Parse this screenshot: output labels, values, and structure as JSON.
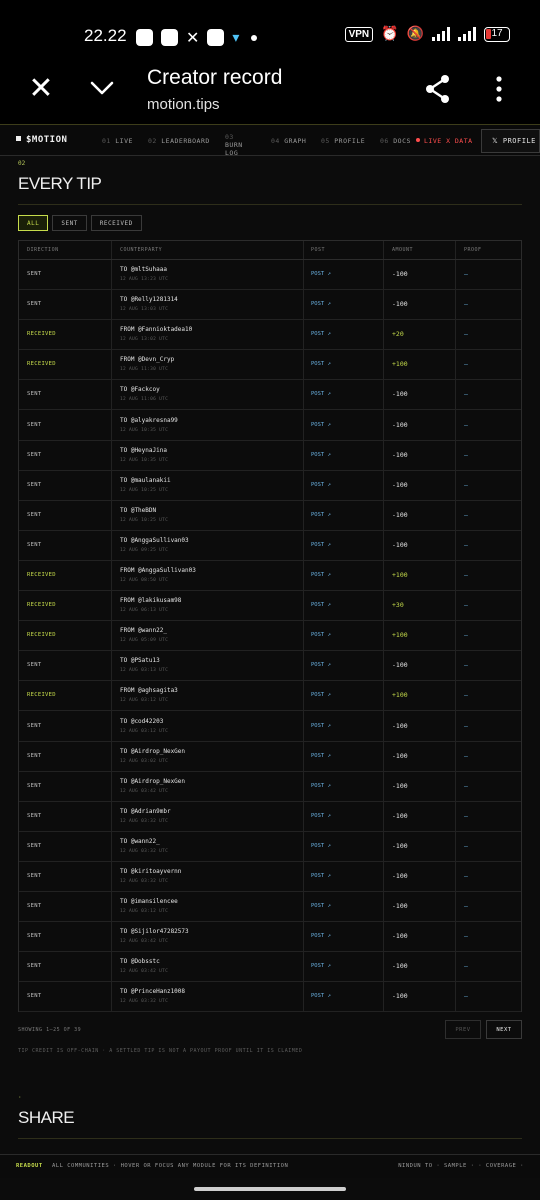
{
  "status_bar": {
    "time": "22.22",
    "vpn": "VPN",
    "battery": "17"
  },
  "browser": {
    "title": "Creator record",
    "url": "motion.tips"
  },
  "nav": {
    "brand": "$MOTION",
    "items": [
      {
        "num": "01",
        "label": "LIVE"
      },
      {
        "num": "02",
        "label": "LEADERBOARD"
      },
      {
        "num": "03",
        "label": "BURN LOG"
      },
      {
        "num": "04",
        "label": "GRAPH"
      },
      {
        "num": "05",
        "label": "PROFILE"
      },
      {
        "num": "06",
        "label": "DOCS"
      }
    ],
    "live_data": "LIVE X DATA",
    "profile_button": "𝕏 PROFILE"
  },
  "section": {
    "num": "02",
    "title": "EVERY TIP",
    "filters": [
      "ALL",
      "SENT",
      "RECEIVED"
    ],
    "active_filter": "ALL"
  },
  "table": {
    "headers": [
      "DIRECTION",
      "COUNTERPARTY",
      "POST",
      "AMOUNT",
      "PROOF"
    ],
    "rows": [
      {
        "dir": "SENT",
        "cp": "TO @mltSuhaaa",
        "time": "12 AUG 13:23 UTC",
        "post": "POST ↗",
        "amt": "-100",
        "proof": "—"
      },
      {
        "dir": "SENT",
        "cp": "TO @Relly1281314",
        "time": "12 AUG 13:03 UTC",
        "post": "POST ↗",
        "amt": "-100",
        "proof": "—"
      },
      {
        "dir": "RECEIVED",
        "cp": "FROM @Fannioktadea10",
        "time": "12 AUG 13:02 UTC",
        "post": "POST ↗",
        "amt": "+20",
        "proof": "—"
      },
      {
        "dir": "RECEIVED",
        "cp": "FROM @Devn_Cryp",
        "time": "12 AUG 11:30 UTC",
        "post": "POST ↗",
        "amt": "+100",
        "proof": "—"
      },
      {
        "dir": "SENT",
        "cp": "TO @Fackcoy",
        "time": "12 AUG 11:06 UTC",
        "post": "POST ↗",
        "amt": "-100",
        "proof": "—"
      },
      {
        "dir": "SENT",
        "cp": "TO @alyakresna99",
        "time": "12 AUG 10:35 UTC",
        "post": "POST ↗",
        "amt": "-100",
        "proof": "—"
      },
      {
        "dir": "SENT",
        "cp": "TO @HeynaJina",
        "time": "12 AUG 10:35 UTC",
        "post": "POST ↗",
        "amt": "-100",
        "proof": "—"
      },
      {
        "dir": "SENT",
        "cp": "TO @maulanakii",
        "time": "12 AUG 10:25 UTC",
        "post": "POST ↗",
        "amt": "-100",
        "proof": "—"
      },
      {
        "dir": "SENT",
        "cp": "TO @TheBDN",
        "time": "12 AUG 10:25 UTC",
        "post": "POST ↗",
        "amt": "-100",
        "proof": "—"
      },
      {
        "dir": "SENT",
        "cp": "TO @AnggaSullivan03",
        "time": "12 AUG 09:25 UTC",
        "post": "POST ↗",
        "amt": "-100",
        "proof": "—"
      },
      {
        "dir": "RECEIVED",
        "cp": "FROM @AnggaSullivan03",
        "time": "12 AUG 08:50 UTC",
        "post": "POST ↗",
        "amt": "+100",
        "proof": "—"
      },
      {
        "dir": "RECEIVED",
        "cp": "FROM @lakikusam98",
        "time": "12 AUG 06:13 UTC",
        "post": "POST ↗",
        "amt": "+30",
        "proof": "—"
      },
      {
        "dir": "RECEIVED",
        "cp": "FROM @wann22_",
        "time": "12 AUG 05:09 UTC",
        "post": "POST ↗",
        "amt": "+100",
        "proof": "—"
      },
      {
        "dir": "SENT",
        "cp": "TO @PSatu13",
        "time": "12 AUG 03:13 UTC",
        "post": "POST ↗",
        "amt": "-100",
        "proof": "—"
      },
      {
        "dir": "RECEIVED",
        "cp": "FROM @aghsagita3",
        "time": "12 AUG 03:12 UTC",
        "post": "POST ↗",
        "amt": "+100",
        "proof": "—"
      },
      {
        "dir": "SENT",
        "cp": "TO @cod42203",
        "time": "12 AUG 03:12 UTC",
        "post": "POST ↗",
        "amt": "-100",
        "proof": "—"
      },
      {
        "dir": "SENT",
        "cp": "TO @Airdrop_NexGen",
        "time": "12 AUG 03:02 UTC",
        "post": "POST ↗",
        "amt": "-100",
        "proof": "—"
      },
      {
        "dir": "SENT",
        "cp": "TO @Airdrop_NexGen",
        "time": "12 AUG 03:42 UTC",
        "post": "POST ↗",
        "amt": "-100",
        "proof": "—"
      },
      {
        "dir": "SENT",
        "cp": "TO @Adrian9mbr",
        "time": "12 AUG 03:32 UTC",
        "post": "POST ↗",
        "amt": "-100",
        "proof": "—"
      },
      {
        "dir": "SENT",
        "cp": "TO @wann22_",
        "time": "12 AUG 03:32 UTC",
        "post": "POST ↗",
        "amt": "-100",
        "proof": "—"
      },
      {
        "dir": "SENT",
        "cp": "TO @kiritoayvernn",
        "time": "12 AUG 03:32 UTC",
        "post": "POST ↗",
        "amt": "-100",
        "proof": "—"
      },
      {
        "dir": "SENT",
        "cp": "TO @imansilencee",
        "time": "12 AUG 03:12 UTC",
        "post": "POST ↗",
        "amt": "-100",
        "proof": "—"
      },
      {
        "dir": "SENT",
        "cp": "TO @Sijilor47282573",
        "time": "12 AUG 03:42 UTC",
        "post": "POST ↗",
        "amt": "-100",
        "proof": "—"
      },
      {
        "dir": "SENT",
        "cp": "TO @Dobsstc",
        "time": "12 AUG 03:42 UTC",
        "post": "POST ↗",
        "amt": "-100",
        "proof": "—"
      },
      {
        "dir": "SENT",
        "cp": "TO @PrinceHanz1008",
        "time": "12 AUG 03:32 UTC",
        "post": "POST ↗",
        "amt": "-100",
        "proof": "—"
      }
    ]
  },
  "pagination": {
    "showing": "SHOWING 1–25 OF 39",
    "prev": "PREV",
    "next": "NEXT"
  },
  "note": "TIP CREDIT IS OFF-CHAIN · A SETTLED TIP IS NOT A PAYOUT PROOF UNTIL IT IS CLAIMED",
  "section2": {
    "num": "·",
    "title": "SHARE"
  },
  "footer": {
    "readout": "READOUT",
    "text": "ALL COMMUNITIES · HOVER OR FOCUS ANY MODULE FOR ITS DEFINITION",
    "right": "NINDUN TO · SAMPLE · · COVERAGE ·"
  },
  "colors": {
    "accent": "#c6dc4b",
    "link": "#6ab0e0",
    "live": "#ff4d4d"
  }
}
